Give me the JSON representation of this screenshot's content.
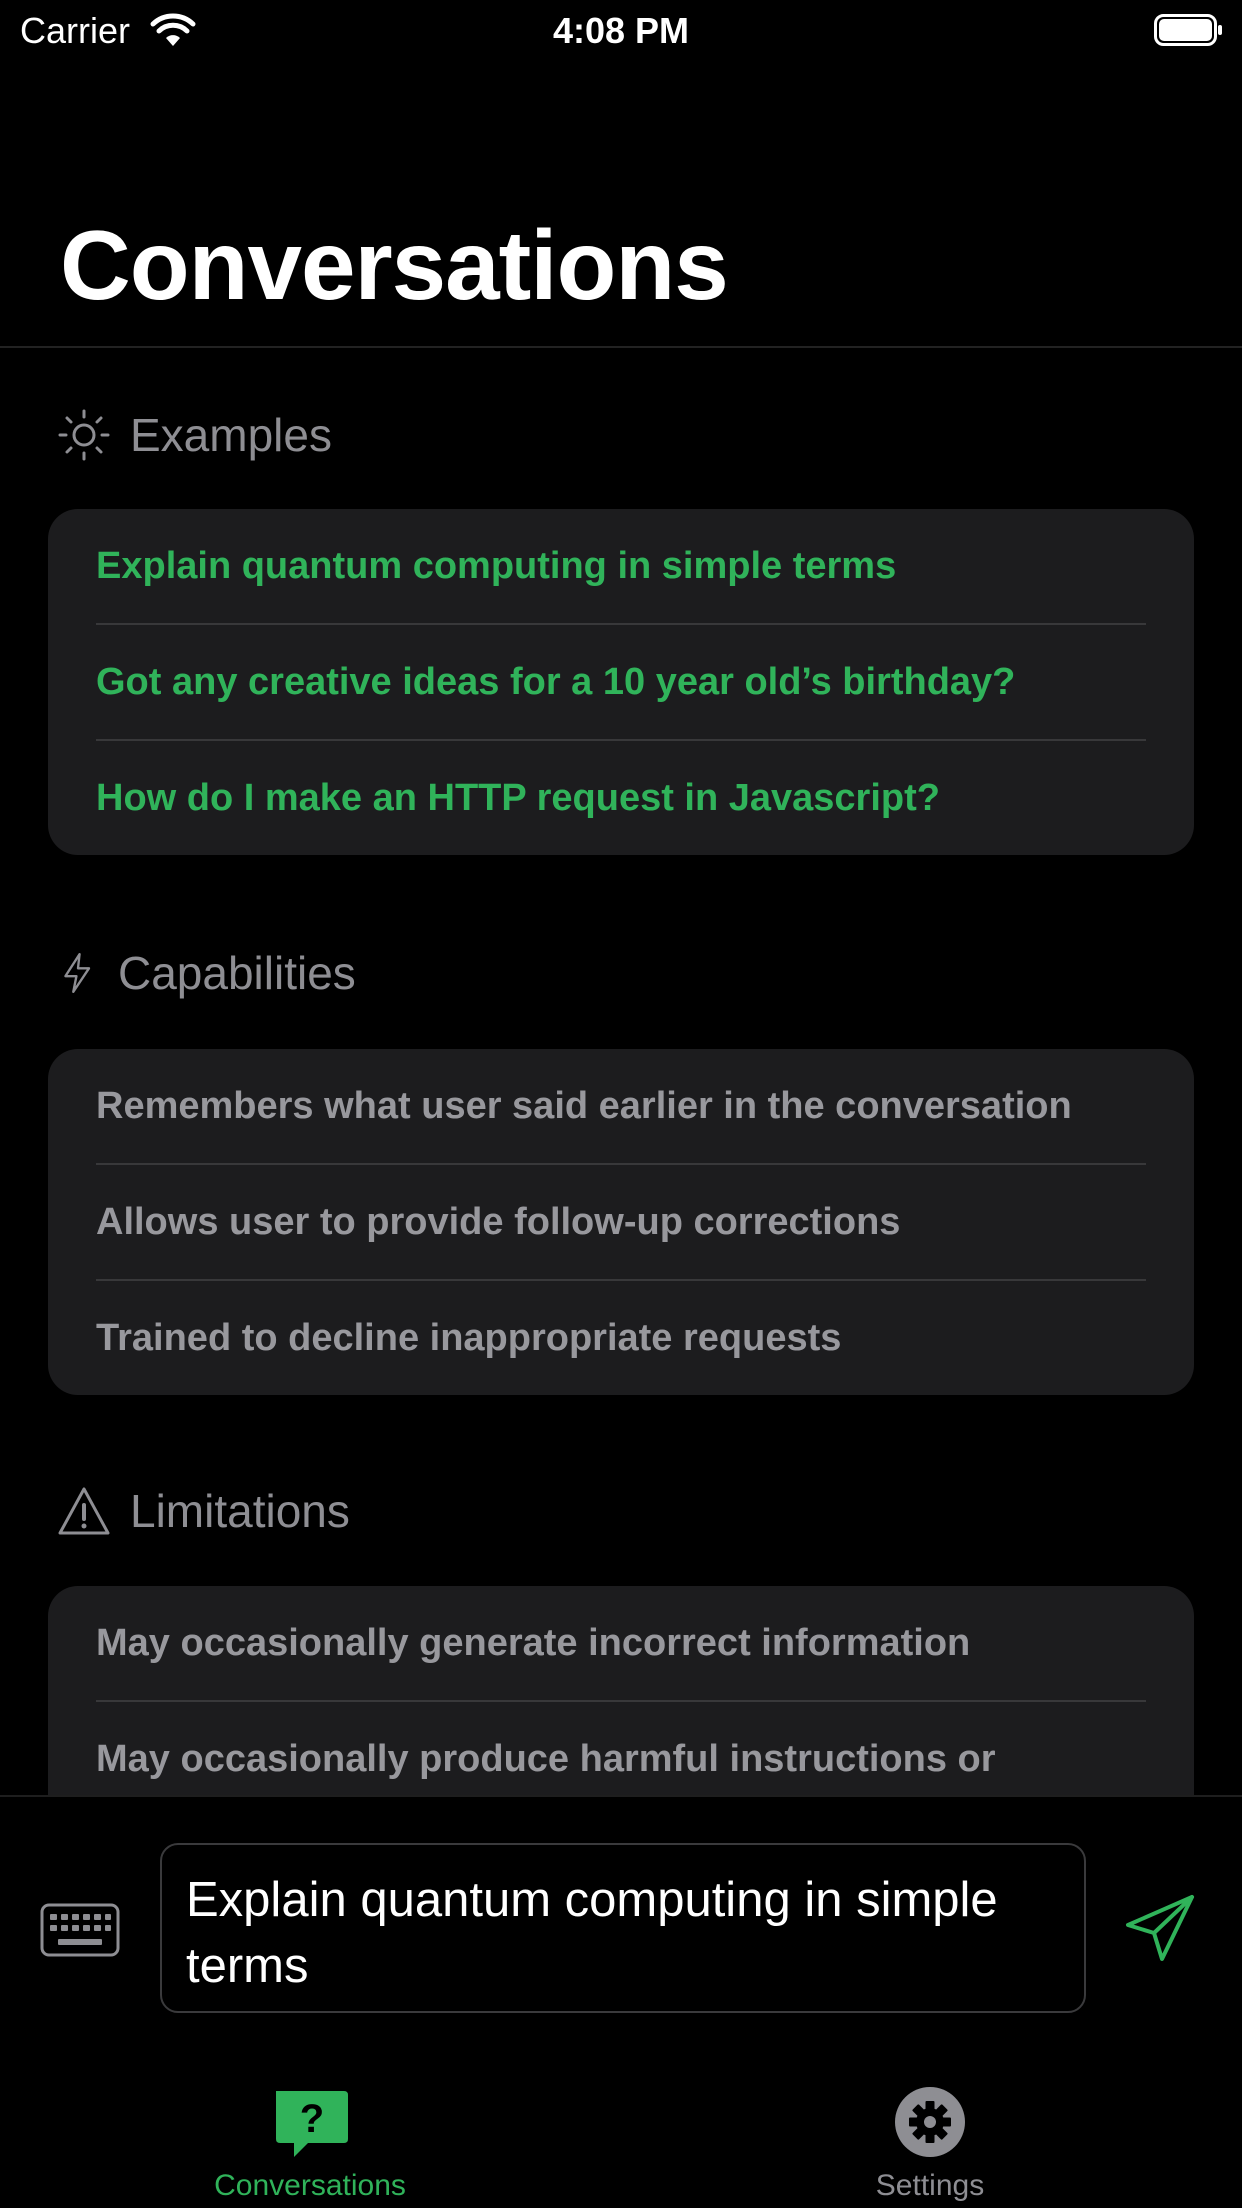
{
  "status_bar": {
    "carrier": "Carrier",
    "time": "4:08 PM"
  },
  "title": "Conversations",
  "sections": {
    "examples": {
      "label": "Examples",
      "icon": "sun-icon",
      "items": [
        "Explain quantum computing in simple terms",
        "Got any creative ideas for a 10 year old’s birthday?",
        "How do I make an HTTP request in Javascript?"
      ]
    },
    "capabilities": {
      "label": "Capabilities",
      "icon": "lightning-icon",
      "items": [
        "Remembers what user said earlier in the conversation",
        "Allows user to provide follow-up corrections",
        "Trained to decline inappropriate requests"
      ]
    },
    "limitations": {
      "label": "Limitations",
      "icon": "warning-icon",
      "items": [
        "May occasionally generate incorrect information",
        "May occasionally produce harmful instructions or"
      ]
    }
  },
  "composer": {
    "value": "Explain quantum computing in simple terms",
    "keyboard_icon": "keyboard-icon",
    "send_icon": "send-icon"
  },
  "tabs": [
    {
      "label": "Conversations",
      "icon": "question-bubble-icon",
      "active": true
    },
    {
      "label": "Settings",
      "icon": "gear-icon",
      "active": false
    }
  ],
  "colors": {
    "accent": "#30b35a",
    "background": "#000000",
    "card": "#1c1c1e",
    "secondary_text": "#98989d"
  }
}
